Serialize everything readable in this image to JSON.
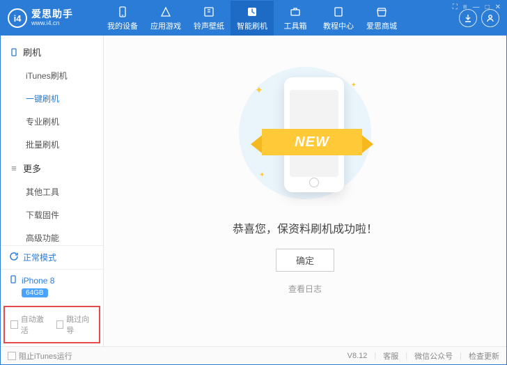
{
  "brand": {
    "name": "爱思助手",
    "url": "www.i4.cn",
    "logo_text": "i4"
  },
  "nav": [
    {
      "label": "我的设备",
      "icon": "device"
    },
    {
      "label": "应用游戏",
      "icon": "apps"
    },
    {
      "label": "铃声壁纸",
      "icon": "music"
    },
    {
      "label": "智能刷机",
      "icon": "flash",
      "active": true
    },
    {
      "label": "工具箱",
      "icon": "tools"
    },
    {
      "label": "教程中心",
      "icon": "book"
    },
    {
      "label": "爱思商城",
      "icon": "store"
    }
  ],
  "sidebar": {
    "group1": {
      "title": "刷机",
      "items": [
        "iTunes刷机",
        "一键刷机",
        "专业刷机",
        "批量刷机"
      ],
      "active_index": 1
    },
    "group2": {
      "title": "更多",
      "items": [
        "其他工具",
        "下载固件",
        "高级功能"
      ]
    },
    "status": "正常模式",
    "device": {
      "name": "iPhone 8",
      "storage": "64GB"
    },
    "checks": {
      "auto_activate": "自动激活",
      "skip_guide": "跳过向导"
    }
  },
  "main": {
    "ribbon": "NEW",
    "message": "恭喜您，保资料刷机成功啦！",
    "ok": "确定",
    "log": "查看日志"
  },
  "statusbar": {
    "block_itunes": "阻止iTunes运行",
    "version": "V8.12",
    "service": "客服",
    "wechat": "微信公众号",
    "update": "检查更新"
  }
}
